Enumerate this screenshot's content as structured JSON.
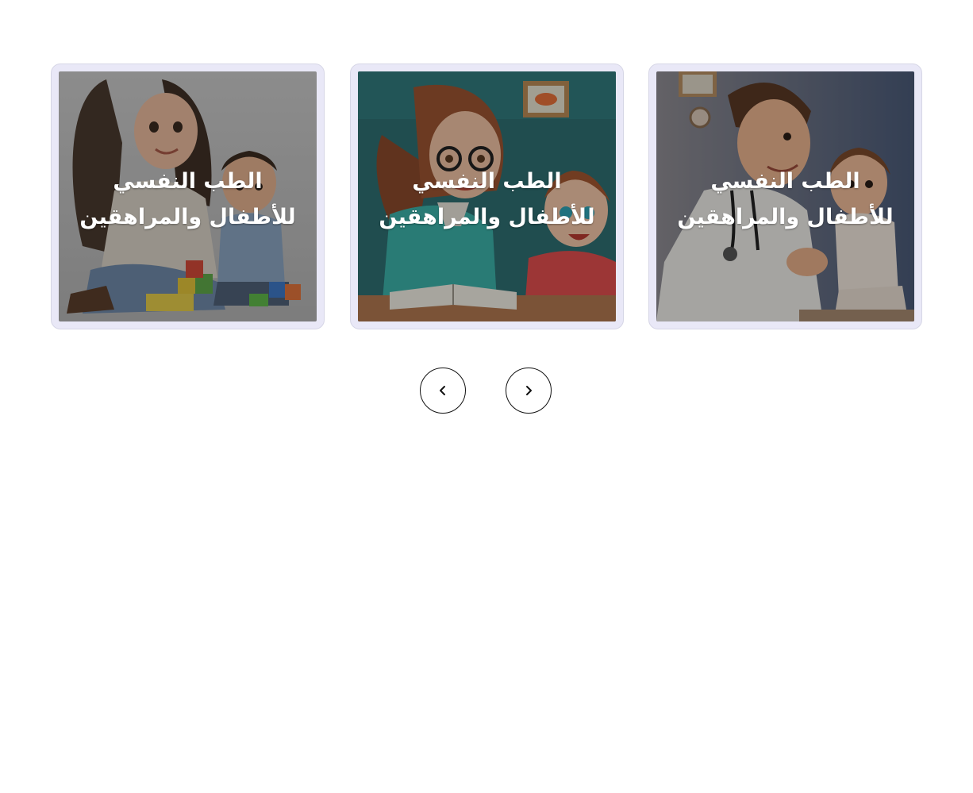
{
  "cards": [
    {
      "title": "الطب النفسي للأطفال والمراهقين",
      "image_icon": "mother-child-playing-blocks-image"
    },
    {
      "title": "الطب النفسي للأطفال والمراهقين",
      "image_icon": "teacher-child-talking-image"
    },
    {
      "title": "الطب النفسي للأطفال والمراهقين",
      "image_icon": "doctor-child-visit-image"
    }
  ],
  "navigation": {
    "prev_icon": "chevron-left-icon",
    "next_icon": "chevron-right-icon"
  },
  "colors": {
    "card_frame": "#e9e8f7",
    "title_text": "#ffffff",
    "button_border": "#111111"
  }
}
